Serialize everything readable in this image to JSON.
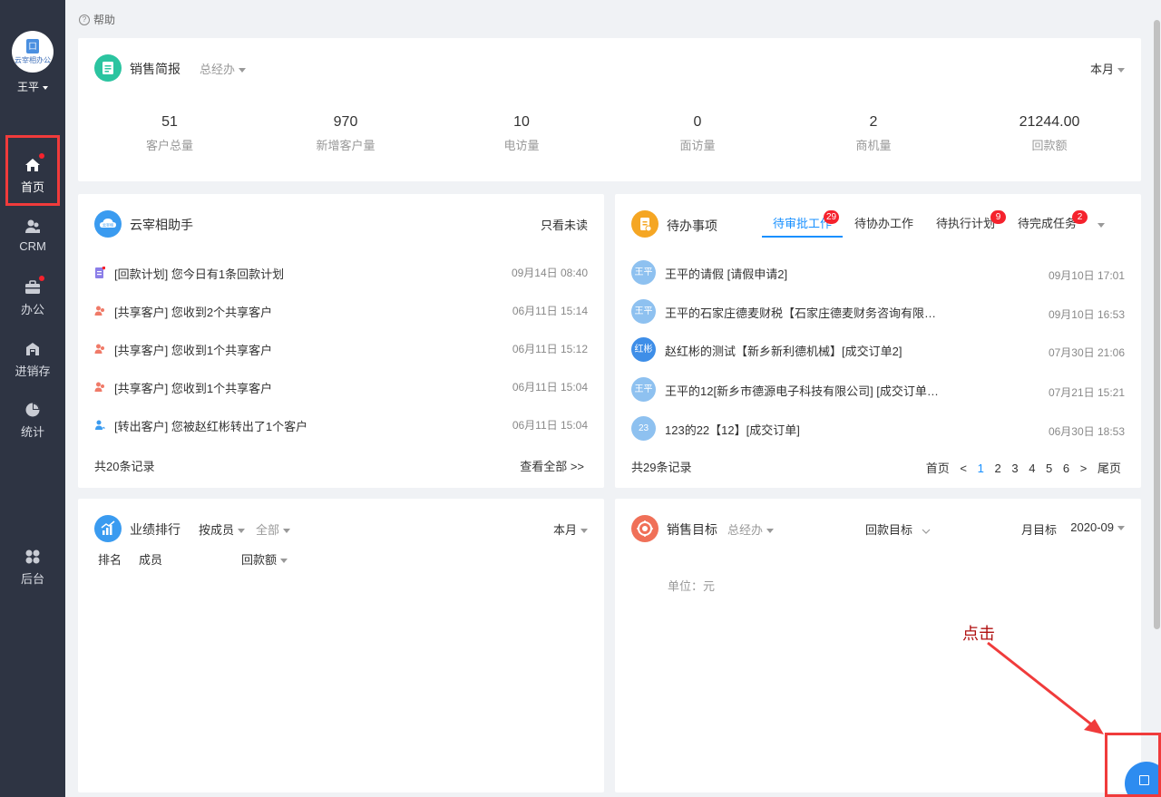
{
  "sidebar": {
    "logo_text": "云宰相办公",
    "user": "王平",
    "items": [
      {
        "label": "首页"
      },
      {
        "label": "CRM"
      },
      {
        "label": "办公"
      },
      {
        "label": "进销存"
      },
      {
        "label": "统计"
      },
      {
        "label": "后台"
      }
    ]
  },
  "help": "帮助",
  "brief": {
    "title": "销售简报",
    "scope": "总经办",
    "period": "本月",
    "stats": [
      {
        "value": "51",
        "label": "客户总量"
      },
      {
        "value": "970",
        "label": "新增客户量"
      },
      {
        "value": "10",
        "label": "电访量"
      },
      {
        "value": "0",
        "label": "面访量"
      },
      {
        "value": "2",
        "label": "商机量"
      },
      {
        "value": "21244.00",
        "label": "回款额"
      }
    ]
  },
  "assistant": {
    "title": "云宰相助手",
    "filter": "只看未读",
    "items": [
      {
        "text": "[回款计划] 您今日有1条回款计划",
        "time": "09月14日 08:40"
      },
      {
        "text": "[共享客户] 您收到2个共享客户",
        "time": "06月11日 15:14"
      },
      {
        "text": "[共享客户] 您收到1个共享客户",
        "time": "06月11日 15:12"
      },
      {
        "text": "[共享客户] 您收到1个共享客户",
        "time": "06月11日 15:04"
      },
      {
        "text": "[转出客户] 您被赵红彬转出了1个客户",
        "time": "06月11日 15:04"
      }
    ],
    "total": "共20条记录",
    "view_all": "查看全部 >>"
  },
  "todo": {
    "title": "待办事项",
    "tabs": [
      {
        "label": "待审批工作",
        "badge": "29"
      },
      {
        "label": "待协办工作",
        "badge": ""
      },
      {
        "label": "待执行计划",
        "badge": "9"
      },
      {
        "label": "待完成任务",
        "badge": "2"
      }
    ],
    "items": [
      {
        "avatar": "王平",
        "text": "王平的请假 [请假申请2]",
        "time": "09月10日 17:01"
      },
      {
        "avatar": "王平",
        "text": "王平的石家庄德麦财税【石家庄德麦财务咨询有限…",
        "time": "09月10日 16:53"
      },
      {
        "avatar": "红彬",
        "text": "赵红彬的测试【新乡新利德机械】[成交订单2]",
        "time": "07月30日 21:06"
      },
      {
        "avatar": "王平",
        "text": "王平的12[新乡市德源电子科技有限公司] [成交订单…",
        "time": "07月21日 15:21"
      },
      {
        "avatar": "23",
        "text": "123的22【12】[成交订单]",
        "time": "06月30日 18:53"
      }
    ],
    "total": "共29条记录",
    "pager": {
      "first": "首页",
      "prev": "<",
      "pages": [
        "1",
        "2",
        "3",
        "4",
        "5",
        "6"
      ],
      "next": ">",
      "last": "尾页",
      "current": "1"
    }
  },
  "ranking": {
    "title": "业绩排行",
    "by": "按成员",
    "scope": "全部",
    "period": "本月",
    "columns": [
      "排名",
      "成员",
      "回款额"
    ]
  },
  "target": {
    "title": "销售目标",
    "scope": "总经办",
    "type": "回款目标",
    "period_type": "月目标",
    "month": "2020-09",
    "unit": "单位：元"
  },
  "annotation": "点击",
  "colors": {
    "sidebar": "#2e3443",
    "accent": "#1890ff",
    "badge": "#f5222d",
    "highlight": "#f03b3b"
  }
}
